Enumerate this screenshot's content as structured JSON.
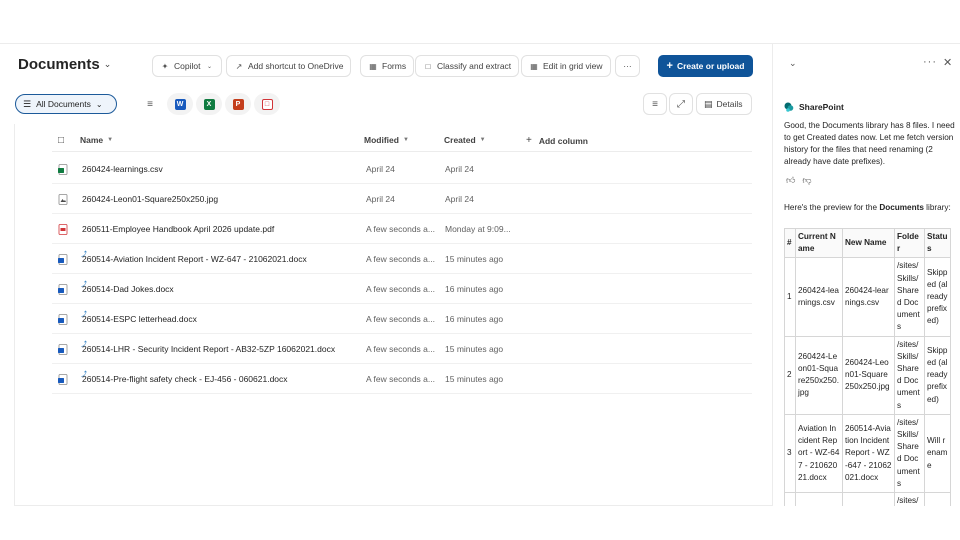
{
  "library": {
    "title": "Documents",
    "toolbar": {
      "copilot": "Copilot",
      "add_shortcut": "Add shortcut to OneDrive",
      "forms": "Forms",
      "classify": "Classify and extract",
      "grid": "Edit in grid view",
      "more": "···",
      "create": "Create or upload"
    },
    "view": "All Documents",
    "details": "Details",
    "columns": {
      "name": "Name",
      "modified": "Modified",
      "created": "Created",
      "add": "Add column"
    },
    "files": [
      {
        "name": "260424-learnings.csv",
        "modified": "April 24",
        "created": "April 24",
        "type": "csv",
        "sync": false
      },
      {
        "name": "260424-Leon01-Square250x250.jpg",
        "modified": "April 24",
        "created": "April 24",
        "type": "img",
        "sync": false
      },
      {
        "name": "260511-Employee Handbook April 2026 update.pdf",
        "modified": "A few seconds a...",
        "created": "Monday at 9:09...",
        "type": "pdf",
        "sync": false
      },
      {
        "name": "260514-Aviation Incident Report - WZ-647 - 21062021.docx",
        "modified": "A few seconds a...",
        "created": "15 minutes ago",
        "type": "docx",
        "sync": true
      },
      {
        "name": "260514-Dad Jokes.docx",
        "modified": "A few seconds a...",
        "created": "16 minutes ago",
        "type": "docx",
        "sync": true
      },
      {
        "name": "260514-ESPC letterhead.docx",
        "modified": "A few seconds a...",
        "created": "16 minutes ago",
        "type": "docx",
        "sync": true
      },
      {
        "name": "260514-LHR - Security Incident Report - AB32-5ZP 16062021.docx",
        "modified": "A few seconds a...",
        "created": "15 minutes ago",
        "type": "docx",
        "sync": true
      },
      {
        "name": "260514-Pre-flight safety check - EJ-456 - 060621.docx",
        "modified": "A few seconds a...",
        "created": "15 minutes ago",
        "type": "docx",
        "sync": true
      }
    ]
  },
  "panel": {
    "agent": "SharePoint",
    "message": "Good, the Documents library has 8 files. I need to get Created dates now. Let me fetch version history for the files that need renaming (2 already have date prefixes).",
    "preview_intro": "Here's the preview for the ",
    "preview_bold": "Documents",
    "preview_end": " library:",
    "table_headers": [
      "#",
      "Current Name",
      "New Name",
      "Folder",
      "Status"
    ],
    "table_rows": [
      [
        "1",
        "260424-learnings.csv",
        "260424-learnings.csv",
        "/sites/Skills/Shared Documents",
        "Skipped (already prefixed)"
      ],
      [
        "2",
        "260424-Leon01-Square250x250.jpg",
        "260424-Leon01-Square250x250.jpg",
        "/sites/Skills/Shared Documents",
        "Skipped (already prefixed)"
      ],
      [
        "3",
        "Aviation Incident Report - WZ-647 - 21062021.docx",
        "260514-Aviation Incident Report - WZ-647 - 21062021.docx",
        "/sites/Skills/Shared Documents",
        "Will rename"
      ],
      [
        "",
        "",
        "",
        "/sites/",
        ""
      ]
    ]
  },
  "colors": {
    "primary": "#0f5499",
    "accent": "#0f6cbd"
  }
}
